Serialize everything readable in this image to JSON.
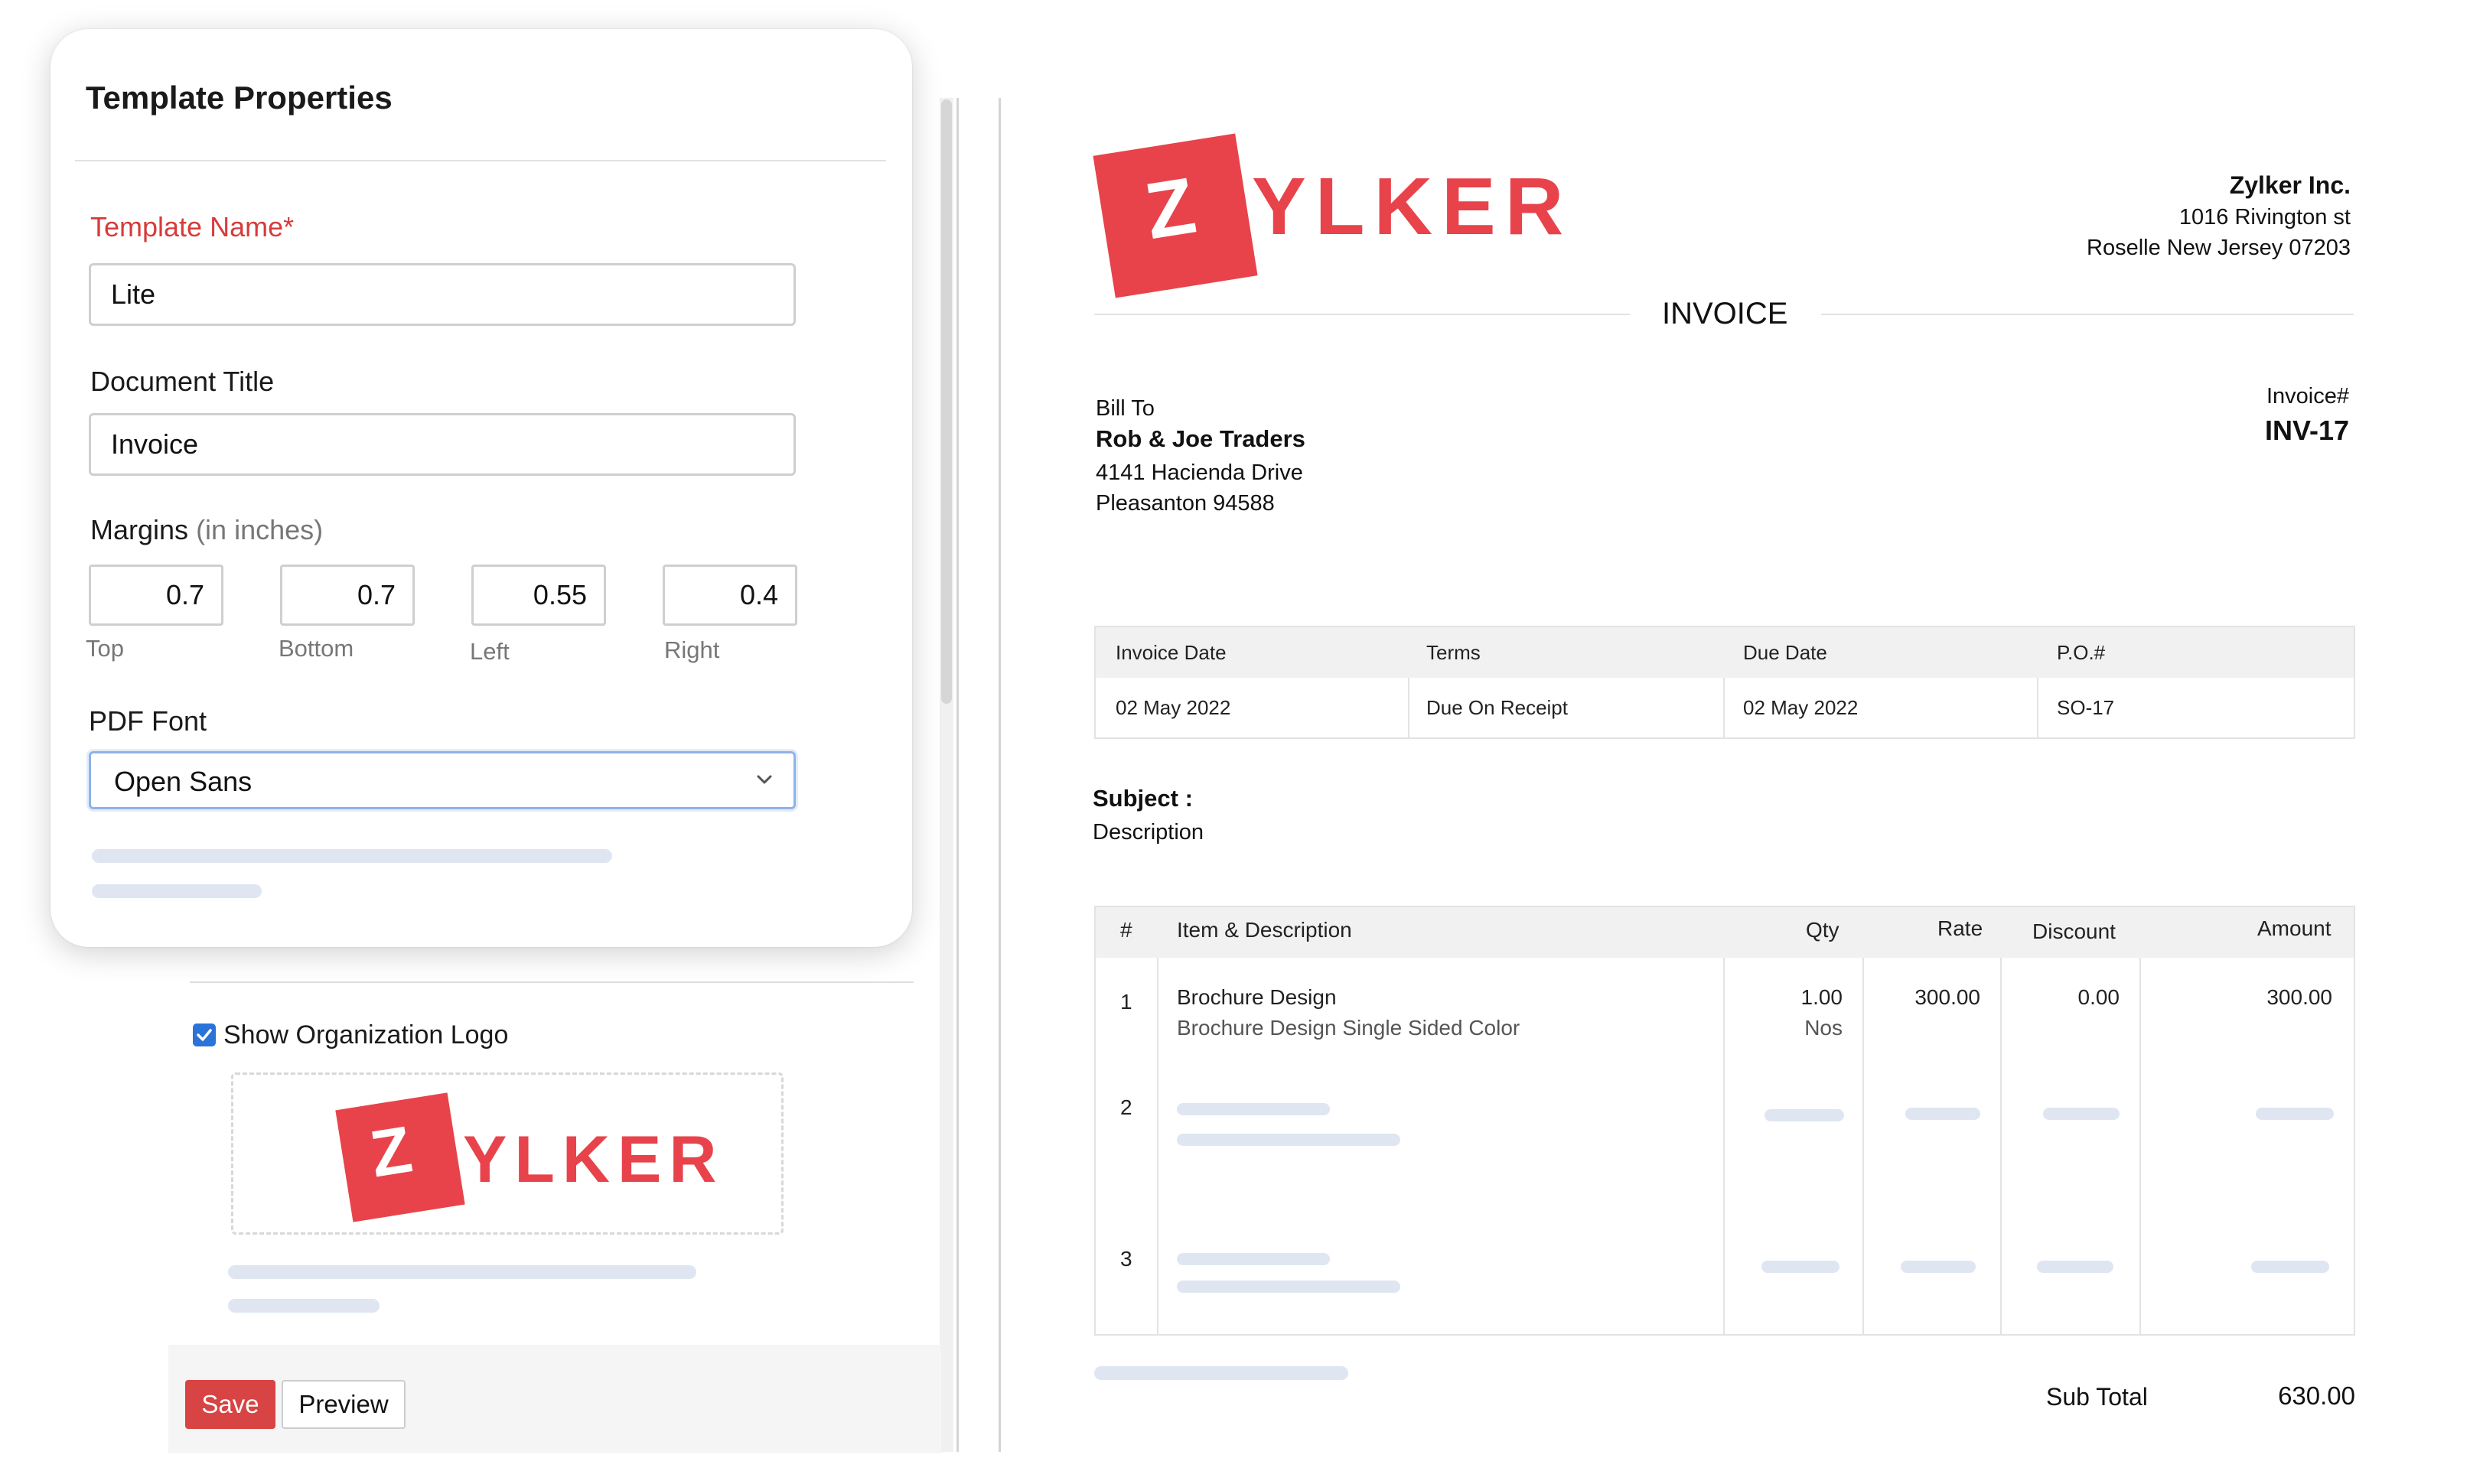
{
  "panel": {
    "title": "Template Properties",
    "template_name_label": "Template Name*",
    "template_name_value": "Lite",
    "document_title_label": "Document Title",
    "document_title_value": "Invoice",
    "margins_label": "Margins",
    "margins_unit": "(in inches)",
    "margins": [
      {
        "label": "Top",
        "value": "0.7"
      },
      {
        "label": "Bottom",
        "value": "0.7"
      },
      {
        "label": "Left",
        "value": "0.55"
      },
      {
        "label": "Right",
        "value": "0.4"
      }
    ],
    "pdf_font_label": "PDF Font",
    "pdf_font_value": "Open Sans"
  },
  "logo_section": {
    "show_logo_label": "Show Organization Logo",
    "show_logo_checked": true
  },
  "logo": {
    "mark": "Z",
    "rest": "YLKER",
    "color": "#e8434b"
  },
  "actions": {
    "save_label": "Save",
    "preview_label": "Preview"
  },
  "invoice": {
    "company_name": "Zylker Inc.",
    "company_address_1": "1016 Rivington st",
    "company_address_2": "Roselle New Jersey 07203",
    "doc_title": "INVOICE",
    "bill_to_label": "Bill To",
    "customer_name": "Rob & Joe Traders",
    "customer_address_1": "4141 Hacienda Drive",
    "customer_address_2": "Pleasanton 94588",
    "invoice_no_label": "Invoice#",
    "invoice_no": "INV-17",
    "meta_headers": [
      "Invoice Date",
      "Terms",
      "Due Date",
      "P.O.#"
    ],
    "meta_values": [
      "02 May 2022",
      "Due On Receipt",
      "02 May 2022",
      "SO-17"
    ],
    "subject_label": "Subject :",
    "description_label": "Description",
    "items_headers": {
      "num": "#",
      "item": "Item & Description",
      "qty": "Qty",
      "rate": "Rate",
      "discount": "Discount",
      "amount": "Amount"
    },
    "items": [
      {
        "num": "1",
        "name": "Brochure Design",
        "desc": "Brochure Design Single Sided Color",
        "qty": "1.00",
        "unit": "Nos",
        "rate": "300.00",
        "discount": "0.00",
        "amount": "300.00"
      },
      {
        "num": "2"
      },
      {
        "num": "3"
      }
    ],
    "subtotal_label": "Sub Total",
    "subtotal_value": "630.00"
  }
}
